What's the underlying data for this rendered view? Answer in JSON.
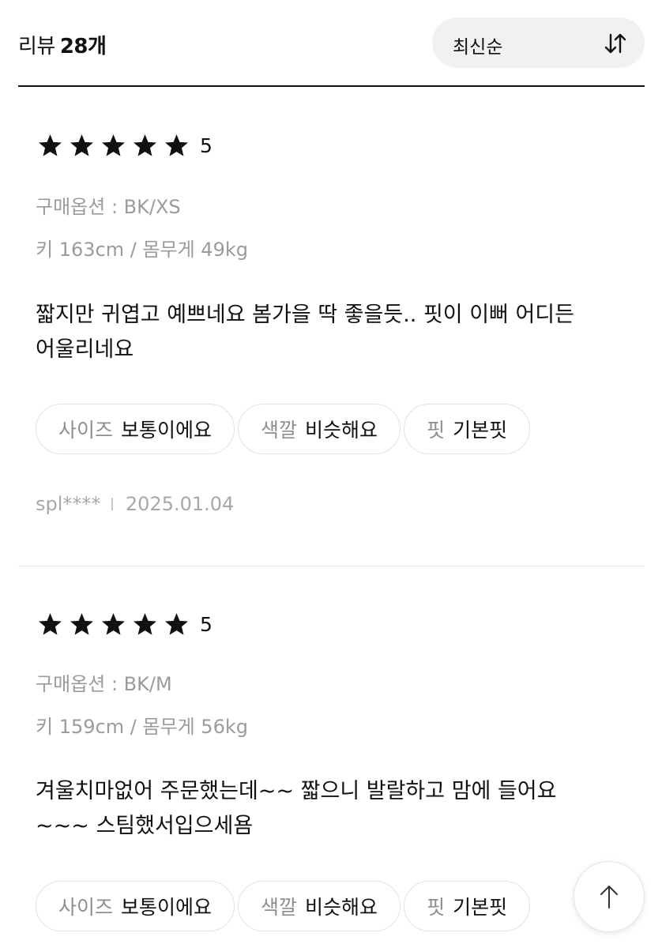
{
  "header": {
    "label": "리뷰",
    "count": "28개",
    "sort": {
      "label": "최신순",
      "icon": "sort-arrows-icon"
    }
  },
  "reviews": [
    {
      "rating": 5,
      "score": "5",
      "option": "구매옵션 : BK/XS",
      "body_info": "키 163cm / 몸무게 49kg",
      "text_lines": [
        "짧지만 귀엽고 예쁘네요 봄가을 딱 좋을듯.. 핏이 이뻐 어디든",
        "어울리네요"
      ],
      "tags": [
        {
          "key": "사이즈",
          "value": "보통이에요"
        },
        {
          "key": "색깔",
          "value": "비슷해요"
        },
        {
          "key": "핏",
          "value": "기본핏"
        }
      ],
      "user": "spl****",
      "date": "2025.01.04"
    },
    {
      "rating": 5,
      "score": "5",
      "option": "구매옵션 : BK/M",
      "body_info": "키 159cm / 몸무게 56kg",
      "text_lines": [
        "겨울치마없어 주문했는데~~ 짧으니 발랄하고 맘에 들어요",
        "~~~ 스팀했서입으세욤"
      ],
      "tags": [
        {
          "key": "사이즈",
          "value": "보통이에요"
        },
        {
          "key": "색깔",
          "value": "비슷해요"
        },
        {
          "key": "핏",
          "value": "기본핏"
        }
      ]
    }
  ],
  "scroll_top_button": {
    "icon": "arrow-up-icon"
  },
  "colors": {
    "text": "#111111",
    "muted": "#9b9b9b",
    "chip_bg": "#f1f1f1",
    "border": "#e2e2e2"
  }
}
